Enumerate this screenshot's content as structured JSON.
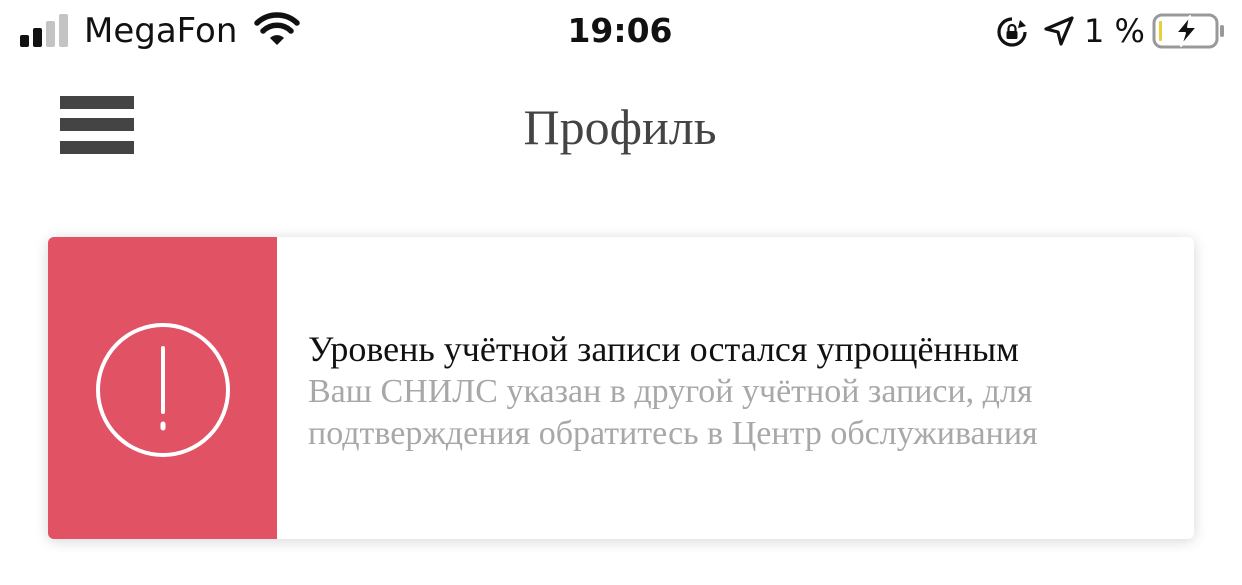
{
  "status_bar": {
    "carrier": "MegaFon",
    "time": "19:06",
    "battery_percent": "1 %",
    "battery_level": 0.01,
    "icons": [
      "signal-icon",
      "wifi-icon",
      "rotation-lock-icon",
      "location-arrow-icon",
      "battery-charging-icon"
    ]
  },
  "header": {
    "menu_icon": "hamburger-menu-icon",
    "title": "Профиль"
  },
  "alert": {
    "icon": "exclamation-circle-icon",
    "accent_color": "#e05264",
    "title": "Уровень учётной записи остался упрощённым",
    "message": "Ваш СНИЛС указан в другой учётной записи, для подтверждения обратитесь в Центр обслуживания"
  }
}
